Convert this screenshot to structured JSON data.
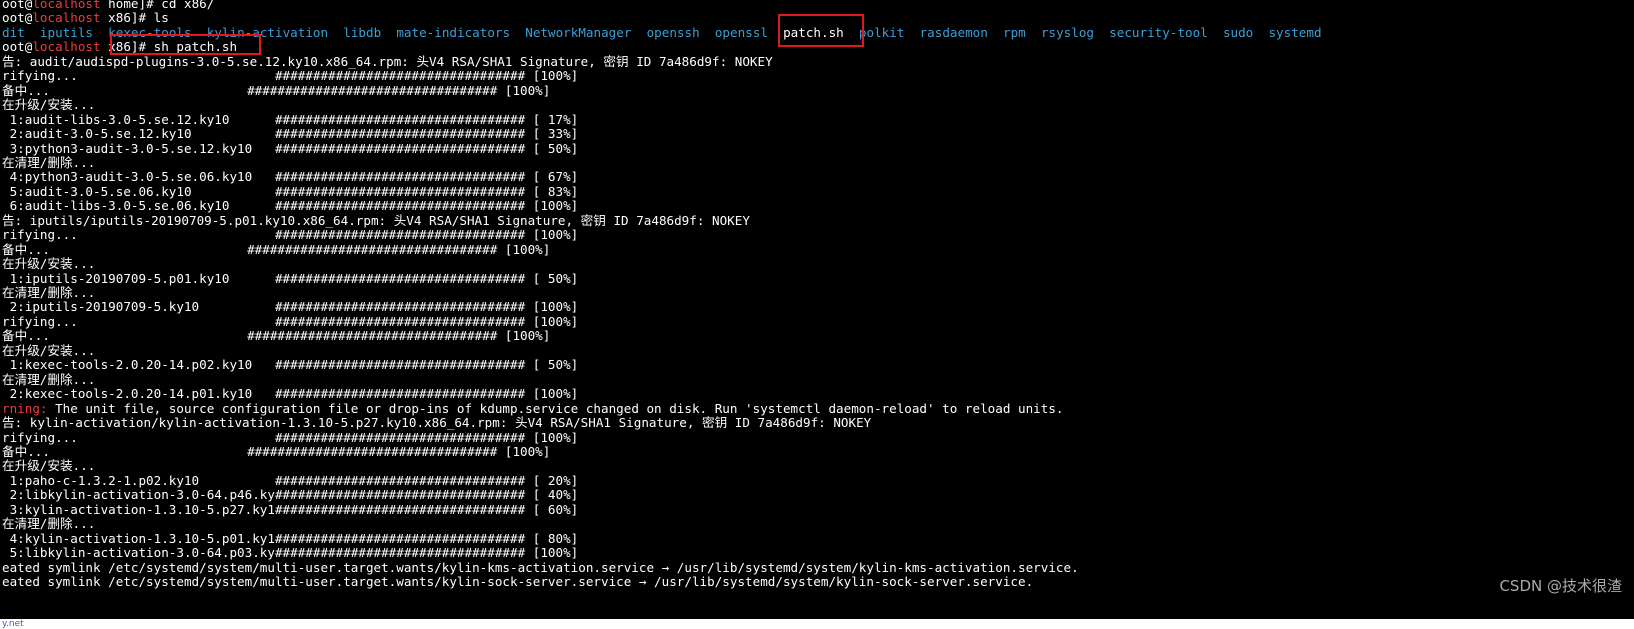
{
  "colors": {
    "terminal_bg": "#000000",
    "text": "#ffffff",
    "prompt_red": "#ee3b3b",
    "dir_cyan": "#3a9fd9",
    "highlight": "#e0191f"
  },
  "lines": [
    {
      "segments": [
        {
          "t": "oot@",
          "c": "white"
        },
        {
          "t": "localhost",
          "c": "red"
        },
        {
          "t": " home]# cd x86/",
          "c": "white"
        }
      ]
    },
    {
      "segments": [
        {
          "t": "oot@",
          "c": "white"
        },
        {
          "t": "localhost",
          "c": "red"
        },
        {
          "t": " x86]# ls",
          "c": "white"
        }
      ]
    },
    {
      "segments": [
        {
          "t": "dit",
          "c": "cyan"
        },
        {
          "t": "  ",
          "c": "white"
        },
        {
          "t": "iputils",
          "c": "cyan"
        },
        {
          "t": "  ",
          "c": "white"
        },
        {
          "t": "kexec-tools",
          "c": "cyan"
        },
        {
          "t": "  ",
          "c": "white"
        },
        {
          "t": "kylin-activation",
          "c": "cyan"
        },
        {
          "t": "  ",
          "c": "white"
        },
        {
          "t": "libdb",
          "c": "cyan"
        },
        {
          "t": "  ",
          "c": "white"
        },
        {
          "t": "mate-indicators",
          "c": "cyan"
        },
        {
          "t": "  ",
          "c": "white"
        },
        {
          "t": "NetworkManager",
          "c": "cyan"
        },
        {
          "t": "  ",
          "c": "white"
        },
        {
          "t": "openssh",
          "c": "cyan"
        },
        {
          "t": "  ",
          "c": "white"
        },
        {
          "t": "openssl",
          "c": "cyan"
        },
        {
          "t": "  ",
          "c": "white"
        },
        {
          "t": "patch.sh",
          "c": "sel"
        },
        {
          "t": "  ",
          "c": "white"
        },
        {
          "t": "polkit",
          "c": "cyan"
        },
        {
          "t": "  ",
          "c": "white"
        },
        {
          "t": "rasdaemon",
          "c": "cyan"
        },
        {
          "t": "  ",
          "c": "white"
        },
        {
          "t": "rpm",
          "c": "cyan"
        },
        {
          "t": "  ",
          "c": "white"
        },
        {
          "t": "rsyslog",
          "c": "cyan"
        },
        {
          "t": "  ",
          "c": "white"
        },
        {
          "t": "security-tool",
          "c": "cyan"
        },
        {
          "t": "  ",
          "c": "white"
        },
        {
          "t": "sudo",
          "c": "cyan"
        },
        {
          "t": "  ",
          "c": "white"
        },
        {
          "t": "systemd",
          "c": "cyan"
        }
      ]
    },
    {
      "segments": [
        {
          "t": "oot@",
          "c": "white"
        },
        {
          "t": "localhost",
          "c": "red"
        },
        {
          "t": " x86]# sh patch.sh",
          "c": "white"
        }
      ]
    },
    {
      "segments": [
        {
          "t": "告: audit/audispd-plugins-3.0-5.se.12.ky10.x86_64.rpm: 头V4 RSA/SHA1 Signature, 密钥 ID 7a486d9f: NOKEY",
          "c": "white"
        }
      ]
    },
    {
      "segments": [
        {
          "t": "rifying...                          ################################# [100%]",
          "c": "white"
        }
      ]
    },
    {
      "segments": [
        {
          "t": "备中...                          ################################# [100%]",
          "c": "white"
        }
      ]
    },
    {
      "segments": [
        {
          "t": "在升级/安装...",
          "c": "white"
        }
      ]
    },
    {
      "segments": [
        {
          "t": " 1:audit-libs-3.0-5.se.12.ky10      ################################# [ 17%]",
          "c": "white"
        }
      ]
    },
    {
      "segments": [
        {
          "t": " 2:audit-3.0-5.se.12.ky10           ################################# [ 33%]",
          "c": "white"
        }
      ]
    },
    {
      "segments": [
        {
          "t": " 3:python3-audit-3.0-5.se.12.ky10   ################################# [ 50%]",
          "c": "white"
        }
      ]
    },
    {
      "segments": [
        {
          "t": "在清理/删除...",
          "c": "white"
        }
      ]
    },
    {
      "segments": [
        {
          "t": " 4:python3-audit-3.0-5.se.06.ky10   ################################# [ 67%]",
          "c": "white"
        }
      ]
    },
    {
      "segments": [
        {
          "t": " 5:audit-3.0-5.se.06.ky10           ################################# [ 83%]",
          "c": "white"
        }
      ]
    },
    {
      "segments": [
        {
          "t": " 6:audit-libs-3.0-5.se.06.ky10      ################################# [100%]",
          "c": "white"
        }
      ]
    },
    {
      "segments": [
        {
          "t": "告: iputils/iputils-20190709-5.p01.ky10.x86_64.rpm: 头V4 RSA/SHA1 Signature, 密钥 ID 7a486d9f: NOKEY",
          "c": "white"
        }
      ]
    },
    {
      "segments": [
        {
          "t": "rifying...                          ################################# [100%]",
          "c": "white"
        }
      ]
    },
    {
      "segments": [
        {
          "t": "备中...                          ################################# [100%]",
          "c": "white"
        }
      ]
    },
    {
      "segments": [
        {
          "t": "在升级/安装...",
          "c": "white"
        }
      ]
    },
    {
      "segments": [
        {
          "t": " 1:iputils-20190709-5.p01.ky10      ################################# [ 50%]",
          "c": "white"
        }
      ]
    },
    {
      "segments": [
        {
          "t": "在清理/删除...",
          "c": "white"
        }
      ]
    },
    {
      "segments": [
        {
          "t": " 2:iputils-20190709-5.ky10          ################################# [100%]",
          "c": "white"
        }
      ]
    },
    {
      "segments": [
        {
          "t": "rifying...                          ################################# [100%]",
          "c": "white"
        }
      ]
    },
    {
      "segments": [
        {
          "t": "备中...                          ################################# [100%]",
          "c": "white"
        }
      ]
    },
    {
      "segments": [
        {
          "t": "在升级/安装...",
          "c": "white"
        }
      ]
    },
    {
      "segments": [
        {
          "t": " 1:kexec-tools-2.0.20-14.p02.ky10   ################################# [ 50%]",
          "c": "white"
        }
      ]
    },
    {
      "segments": [
        {
          "t": "在清理/删除...",
          "c": "white"
        }
      ]
    },
    {
      "segments": [
        {
          "t": " 2:kexec-tools-2.0.20-14.p01.ky10   ################################# [100%]",
          "c": "white"
        }
      ]
    },
    {
      "segments": [
        {
          "t": "rning: ",
          "c": "red"
        },
        {
          "t": "The unit file, source configuration file or drop-ins of kdump.service changed on disk. Run 'systemctl daemon-reload' to reload units.",
          "c": "white"
        }
      ]
    },
    {
      "segments": [
        {
          "t": "告: kylin-activation/kylin-activation-1.3.10-5.p27.ky10.x86_64.rpm: 头V4 RSA/SHA1 Signature, 密钥 ID 7a486d9f: NOKEY",
          "c": "white"
        }
      ]
    },
    {
      "segments": [
        {
          "t": "rifying...                          ################################# [100%]",
          "c": "white"
        }
      ]
    },
    {
      "segments": [
        {
          "t": "备中...                          ################################# [100%]",
          "c": "white"
        }
      ]
    },
    {
      "segments": [
        {
          "t": "在升级/安装...",
          "c": "white"
        }
      ]
    },
    {
      "segments": [
        {
          "t": " 1:paho-c-1.3.2-1.p02.ky10          ################################# [ 20%]",
          "c": "white"
        }
      ]
    },
    {
      "segments": [
        {
          "t": " 2:libkylin-activation-3.0-64.p46.ky################################# [ 40%]",
          "c": "white"
        }
      ]
    },
    {
      "segments": [
        {
          "t": " 3:kylin-activation-1.3.10-5.p27.ky1################################# [ 60%]",
          "c": "white"
        }
      ]
    },
    {
      "segments": [
        {
          "t": "在清理/删除...",
          "c": "white"
        }
      ]
    },
    {
      "segments": [
        {
          "t": " 4:kylin-activation-1.3.10-5.p01.ky1################################# [ 80%]",
          "c": "white"
        }
      ]
    },
    {
      "segments": [
        {
          "t": " 5:libkylin-activation-3.0-64.p03.ky################################# [100%]",
          "c": "white"
        }
      ]
    },
    {
      "segments": [
        {
          "t": "eated symlink /etc/systemd/system/multi-user.target.wants/kylin-kms-activation.service → /usr/lib/systemd/system/kylin-kms-activation.service.",
          "c": "white"
        }
      ]
    },
    {
      "segments": [
        {
          "t": "eated symlink /etc/systemd/system/multi-user.target.wants/kylin-sock-server.service → /usr/lib/systemd/system/kylin-sock-server.service.",
          "c": "white"
        }
      ]
    }
  ],
  "watermark": "CSDN @技术很渣",
  "bottom_fragment": "y.net"
}
